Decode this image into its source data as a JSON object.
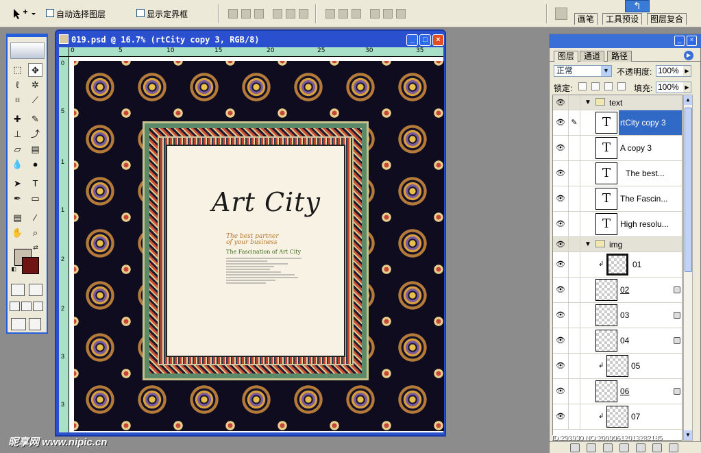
{
  "options_bar": {
    "auto_select_label": "自动选择图层",
    "show_bounds_label": "显示定界框"
  },
  "palette_well": {
    "tabs": [
      "画笔",
      "工具预设",
      "图层复合"
    ]
  },
  "document": {
    "title": "019.psd @ 16.7% (rtCity copy 3, RGB/8)",
    "ruler_h": [
      "0",
      "5",
      "10",
      "15",
      "20",
      "25",
      "30",
      "35"
    ],
    "ruler_v": [
      "0",
      "5",
      "1",
      "1",
      "2",
      "2",
      "3",
      "3"
    ],
    "art": {
      "headline": "Art City",
      "tagline_1": "The best partner",
      "tagline_2": "of your business",
      "subtitle": "The Fascination of Art City"
    }
  },
  "layers_panel": {
    "tabs": [
      "图层",
      "通道",
      "路径"
    ],
    "blend_mode": "正常",
    "opacity_label": "不透明度:",
    "opacity_value": "100%",
    "lock_label": "锁定:",
    "fill_label": "填充:",
    "fill_value": "100%",
    "rows": [
      {
        "name": "text",
        "type": "group"
      },
      {
        "name": "rtCity copy 3",
        "type": "text"
      },
      {
        "name": "A copy 3",
        "type": "text"
      },
      {
        "name": "The best...",
        "type": "text"
      },
      {
        "name": "The Fascin...",
        "type": "text"
      },
      {
        "name": "High resolu...",
        "type": "text"
      },
      {
        "name": "img",
        "type": "group"
      },
      {
        "name": "01",
        "type": "image"
      },
      {
        "name": "02",
        "type": "image"
      },
      {
        "name": "03",
        "type": "image"
      },
      {
        "name": "04",
        "type": "image"
      },
      {
        "name": "05",
        "type": "image"
      },
      {
        "name": "06",
        "type": "image"
      },
      {
        "name": "07",
        "type": "image"
      }
    ]
  },
  "watermark": {
    "site": "昵享网 www.nipic.cn",
    "id": "ID:293930 NO:20090612013282185"
  }
}
